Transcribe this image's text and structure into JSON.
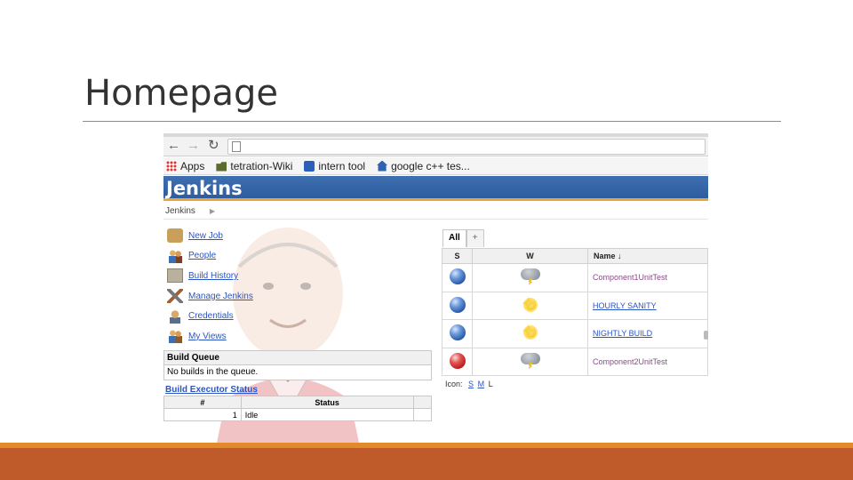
{
  "slide": {
    "title": "Homepage"
  },
  "browser": {
    "bookmarks": [
      {
        "label": "Apps",
        "icon": "apps-grid-icon"
      },
      {
        "label": "tetration-Wiki",
        "icon": "bookmark-folder-icon"
      },
      {
        "label": "intern tool",
        "icon": "intern-tool-icon"
      },
      {
        "label": "google c++ tes...",
        "icon": "house-icon"
      }
    ]
  },
  "jenkins": {
    "logo": "Jenkins",
    "breadcrumb": "Jenkins",
    "tasks": [
      {
        "label": "New Job"
      },
      {
        "label": "People"
      },
      {
        "label": "Build History"
      },
      {
        "label": "Manage Jenkins"
      },
      {
        "label": "Credentials"
      },
      {
        "label": "My Views"
      }
    ],
    "build_queue": {
      "title": "Build Queue",
      "message": "No builds in the queue."
    },
    "executors": {
      "title": "Build Executor Status",
      "columns": [
        "#",
        "Status"
      ],
      "rows": [
        {
          "num": "1",
          "status": "Idle"
        }
      ]
    },
    "views": {
      "active_tab": "All",
      "add_tab": "+"
    },
    "jobs": {
      "columns": {
        "s": "S",
        "w": "W",
        "name": "Name ↓"
      },
      "rows": [
        {
          "status": "blue",
          "weather": "storm",
          "name": "Component1UnitTest"
        },
        {
          "status": "blue",
          "weather": "sunny",
          "name": "HOURLY SANITY"
        },
        {
          "status": "blue",
          "weather": "sunny",
          "name": "NIGHTLY BUILD"
        },
        {
          "status": "red",
          "weather": "storm",
          "name": "Component2UnitTest"
        }
      ]
    },
    "icon_legend": {
      "label": "Icon:",
      "sizes": [
        "S",
        "M",
        "L"
      ]
    }
  },
  "colors": {
    "footer_thin": "#e08a2c",
    "footer_bar": "#bf5a2a",
    "header_blue": "#3d6fb1",
    "link": "#2a55c2"
  }
}
